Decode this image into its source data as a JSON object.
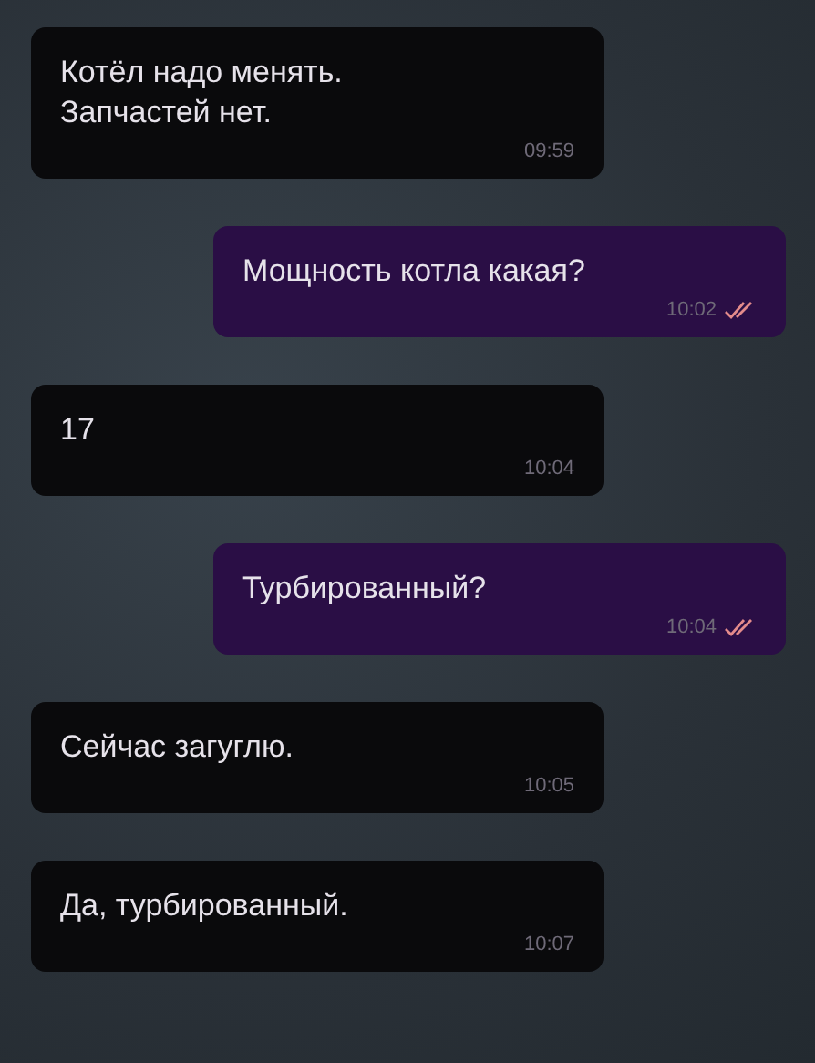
{
  "messages": [
    {
      "kind": "incoming",
      "text": "Котёл надо менять.\nЗапчастей нет.",
      "time": "09:59"
    },
    {
      "kind": "outgoing",
      "text": "Мощность котла какая?",
      "time": "10:02",
      "read": true
    },
    {
      "kind": "incoming",
      "text": "17",
      "time": "10:04"
    },
    {
      "kind": "outgoing",
      "text": "Турбированный?",
      "time": "10:04",
      "read": true
    },
    {
      "kind": "incoming",
      "text": "Сейчас загуглю.",
      "time": "10:05"
    },
    {
      "kind": "incoming",
      "text": "Да, турбированный.",
      "time": "10:07"
    }
  ]
}
